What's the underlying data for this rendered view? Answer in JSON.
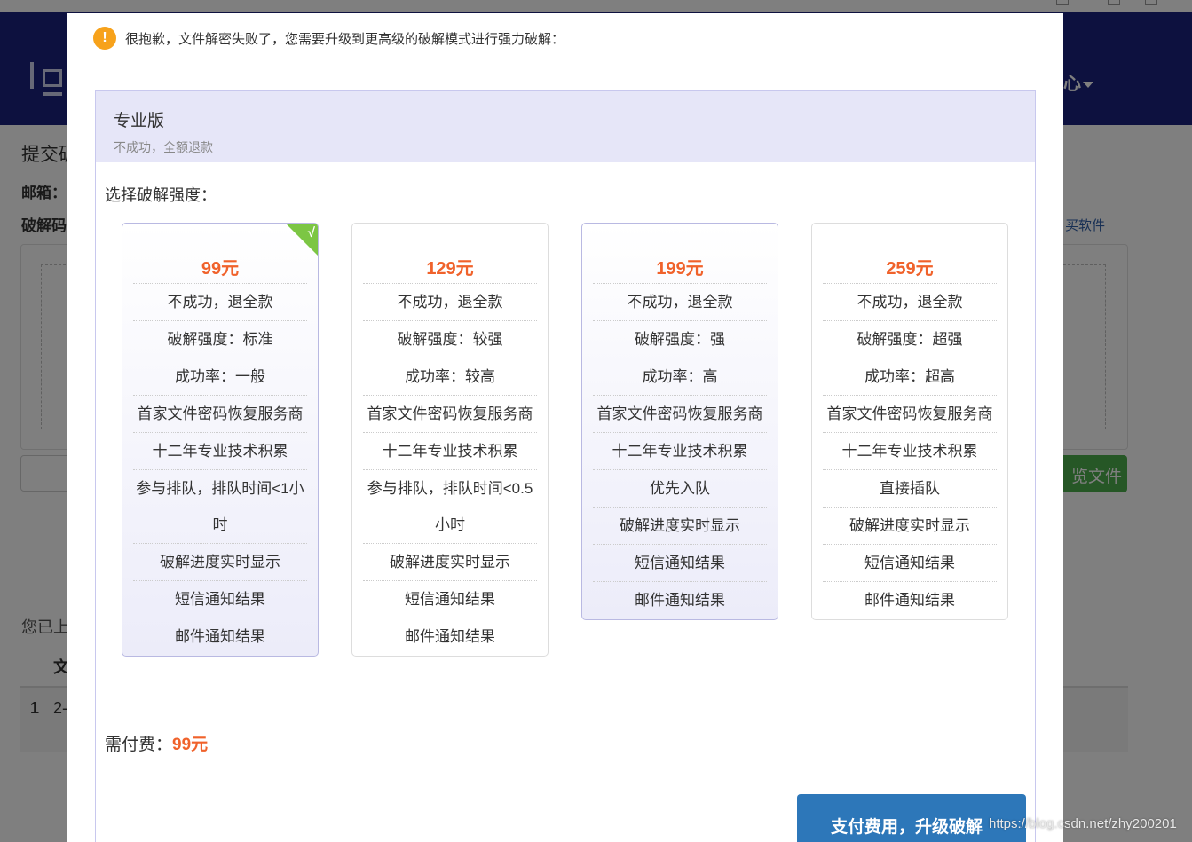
{
  "background": {
    "header_user": "心",
    "title": "提交破",
    "email_label": "邮箱：",
    "crack_label": "破解码",
    "buy_link": "买软件",
    "browse_button": "览文件",
    "uploaded_text": "您已上",
    "table_header": "文",
    "row_no": "1",
    "row_name": "2-"
  },
  "modal": {
    "notice": "很抱歉，文件解密失败了，您需要升级到更高级的破解模式进行强力破解：",
    "panel_title": "专业版",
    "panel_subtitle": "不成功，全额退款",
    "choose_label": "选择破解强度：",
    "plans": [
      {
        "price": "99元",
        "selected": true,
        "check": "√",
        "features": [
          "不成功，退全款",
          "破解强度：标准",
          "成功率：一般",
          "首家文件密码恢复服务商",
          "十二年专业技术积累",
          "参与排队，排队时间<1小时",
          "破解进度实时显示",
          "短信通知结果",
          "邮件通知结果"
        ]
      },
      {
        "price": "129元",
        "selected": false,
        "features": [
          "不成功，退全款",
          "破解强度：较强",
          "成功率：较高",
          "首家文件密码恢复服务商",
          "十二年专业技术积累",
          "参与排队，排队时间<0.5小时",
          "破解进度实时显示",
          "短信通知结果",
          "邮件通知结果"
        ]
      },
      {
        "price": "199元",
        "selected": false,
        "features": [
          "不成功，退全款",
          "破解强度：强",
          "成功率：高",
          "首家文件密码恢复服务商",
          "十二年专业技术积累",
          "优先入队",
          "破解进度实时显示",
          "短信通知结果",
          "邮件通知结果"
        ]
      },
      {
        "price": "259元",
        "selected": false,
        "features": [
          "不成功，退全款",
          "破解强度：超强",
          "成功率：超高",
          "首家文件密码恢复服务商",
          "十二年专业技术积累",
          "直接插队",
          "破解进度实时显示",
          "短信通知结果",
          "邮件通知结果"
        ]
      }
    ],
    "pay_label": "需付费：",
    "pay_amount": "99元",
    "pay_button": "支付费用，升级破解"
  },
  "watermark": "https://blog.csdn.net/zhy200201",
  "colors": {
    "header_bg": "#1a237e",
    "price": "#f0622b",
    "pay_button": "#2d77b9",
    "selected_badge": "#7cc644",
    "warning": "#f7a21b"
  }
}
